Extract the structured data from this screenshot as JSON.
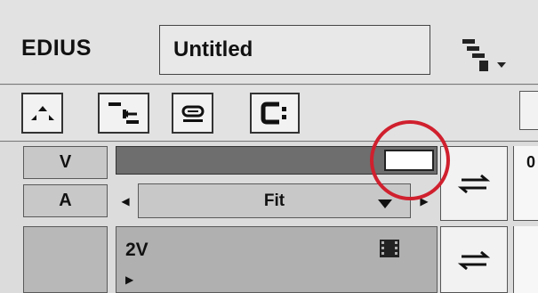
{
  "header": {
    "logo": "EDIUS",
    "title": "Untitled"
  },
  "toolbar": {
    "buttons": [
      {
        "name": "set-in-out-button"
      },
      {
        "name": "insert-overwrite-mode-button"
      },
      {
        "name": "sync-lock-button"
      },
      {
        "name": "ripple-mode-button"
      }
    ]
  },
  "tracks": {
    "v_label": "V",
    "a_label": "A",
    "zoom": "Fit",
    "track_name": "2V",
    "ruler_text": "0"
  },
  "highlight": {
    "color": "#d0202e"
  }
}
